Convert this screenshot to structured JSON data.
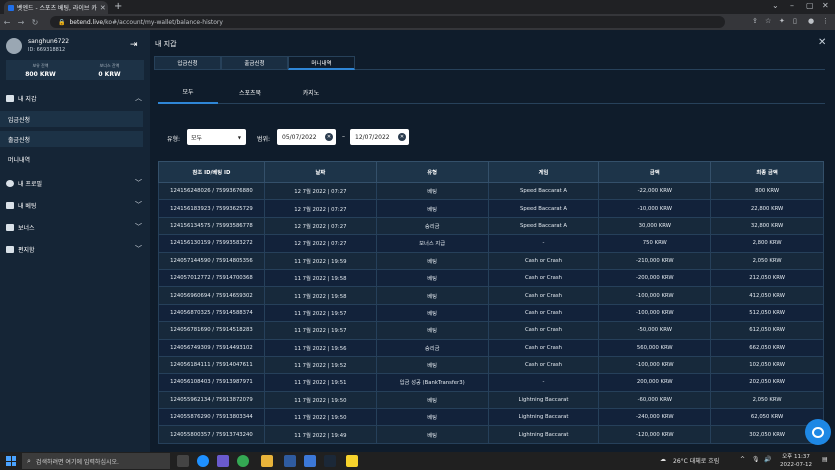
{
  "browser": {
    "tab_title": "벳엔드 - 스포츠 베팅, 라이브 카",
    "url_host": "betend.live",
    "url_path": "/ko#/account/my-wallet/balance-history"
  },
  "sidebar": {
    "username": "sanghun6722",
    "user_id": "ID: 669318812",
    "balance_label": "보유 잔액",
    "balance_value": "800 KRW",
    "bonus_label": "보너스 잔액",
    "bonus_value": "0 KRW",
    "menu": [
      {
        "label": "내 지갑"
      },
      {
        "label": "내 프로필"
      },
      {
        "label": "내 베팅"
      },
      {
        "label": "보너스"
      },
      {
        "label": "편지함"
      }
    ],
    "wallet_sub": [
      {
        "label": "입금신청"
      },
      {
        "label": "출금신청"
      },
      {
        "label": "머니내역"
      }
    ]
  },
  "main": {
    "title": "내 지갑",
    "top_tabs": [
      {
        "label": "입금신청"
      },
      {
        "label": "출금신청"
      },
      {
        "label": "머니내역"
      }
    ],
    "sub_tabs": [
      {
        "label": "모두"
      },
      {
        "label": "스포츠북"
      },
      {
        "label": "카지노"
      }
    ],
    "filter": {
      "type_label": "유형:",
      "type_value": "모두",
      "range_label": "범위:",
      "date_from": "05/07/2022",
      "date_to": "12/07/2022",
      "separator": "–"
    },
    "table": {
      "headers": [
        "참조 ID/베팅 ID",
        "날짜",
        "유형",
        "게임",
        "금액",
        "최종 금액"
      ],
      "rows": [
        [
          "124156248026 / 75993676880",
          "12 7월 2022 | 07:27",
          "베팅",
          "Speed Baccarat A",
          "-22,000 KRW",
          "800 KRW"
        ],
        [
          "124156183923 / 75993625729",
          "12 7월 2022 | 07:27",
          "베팅",
          "Speed Baccarat A",
          "-10,000 KRW",
          "22,800 KRW"
        ],
        [
          "124156134575 / 75993586778",
          "12 7월 2022 | 07:27",
          "승리금",
          "Speed Baccarat A",
          "30,000 KRW",
          "32,800 KRW"
        ],
        [
          "124156130159 / 75993583272",
          "12 7월 2022 | 07:27",
          "보너스 지급",
          "-",
          "750 KRW",
          "2,800 KRW"
        ],
        [
          "124057144590 / 75914805356",
          "11 7월 2022 | 19:59",
          "베팅",
          "Cash or Crash",
          "-210,000 KRW",
          "2,050 KRW"
        ],
        [
          "124057012772 / 75914700368",
          "11 7월 2022 | 19:58",
          "베팅",
          "Cash or Crash",
          "-200,000 KRW",
          "212,050 KRW"
        ],
        [
          "124056960694 / 75914659302",
          "11 7월 2022 | 19:58",
          "베팅",
          "Cash or Crash",
          "-100,000 KRW",
          "412,050 KRW"
        ],
        [
          "124056870325 / 75914588374",
          "11 7월 2022 | 19:57",
          "베팅",
          "Cash or Crash",
          "-100,000 KRW",
          "512,050 KRW"
        ],
        [
          "124056781690 / 75914518283",
          "11 7월 2022 | 19:57",
          "베팅",
          "Cash or Crash",
          "-50,000 KRW",
          "612,050 KRW"
        ],
        [
          "124056749309 / 75914493102",
          "11 7월 2022 | 19:56",
          "승리금",
          "Cash or Crash",
          "560,000 KRW",
          "662,050 KRW"
        ],
        [
          "124056184111 / 75914047611",
          "11 7월 2022 | 19:52",
          "베팅",
          "Cash or Crash",
          "-100,000 KRW",
          "102,050 KRW"
        ],
        [
          "124056108403 / 75913987971",
          "11 7월 2022 | 19:51",
          "입금 성공 (BankTransfer3)",
          "-",
          "200,000 KRW",
          "202,050 KRW"
        ],
        [
          "124055962134 / 75913872079",
          "11 7월 2022 | 19:50",
          "베팅",
          "Lightning Baccarat",
          "-60,000 KRW",
          "2,050 KRW"
        ],
        [
          "124055876290 / 75913803344",
          "11 7월 2022 | 19:50",
          "베팅",
          "Lightning Baccarat",
          "-240,000 KRW",
          "62,050 KRW"
        ],
        [
          "124055800357 / 75913743240",
          "11 7월 2022 | 19:49",
          "베팅",
          "Lightning Baccarat",
          "-120,000 KRW",
          "302,050 KRW"
        ]
      ]
    }
  },
  "taskbar": {
    "search_placeholder": "검색하려면 여기에 입력하십시오.",
    "weather": "26°C 대체로 흐림",
    "time": "오후 11:37",
    "date": "2022-07-12"
  }
}
